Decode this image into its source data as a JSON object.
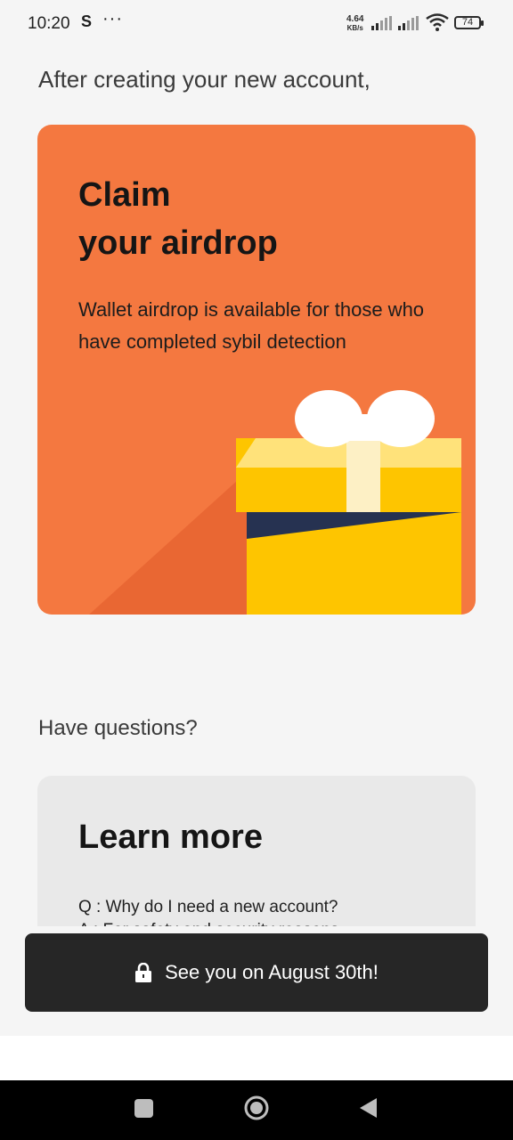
{
  "status_bar": {
    "time": "10:20",
    "s_icon": "S",
    "more": "···",
    "net_speed_value": "4.64",
    "net_speed_unit": "KB/s",
    "battery": "74"
  },
  "intro_text": "After creating your new account,",
  "airdrop_card": {
    "title": "Claim\nyour airdrop",
    "description": "Wallet airdrop is available for those who have completed sybil detection",
    "bg_color": "#f47840",
    "illustration": "gift-box"
  },
  "questions_label": "Have questions?",
  "learn_card": {
    "title": "Learn more",
    "question": "Q :  Why do I need a new account?",
    "answer_partial": "A :  For safety and security reasons..."
  },
  "cta": {
    "label": "See you on August 30th!",
    "icon": "lock-icon"
  },
  "nav": {
    "recents_icon": "square-icon",
    "home_icon": "circle-home-icon",
    "back_icon": "triangle-back-icon"
  }
}
